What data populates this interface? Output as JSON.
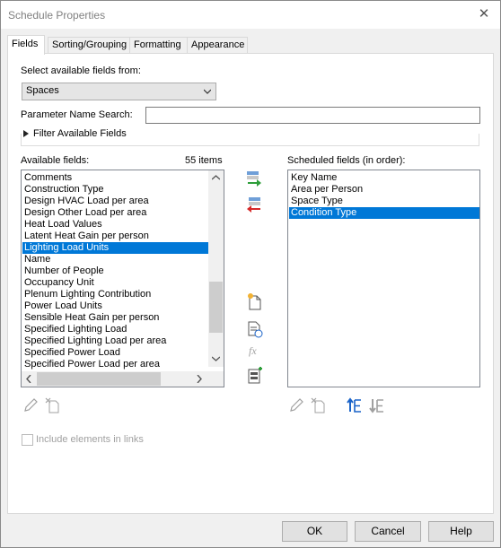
{
  "window": {
    "title": "Schedule Properties",
    "close_glyph": "✕"
  },
  "tabs": [
    {
      "label": "Fields",
      "active": true
    },
    {
      "label": "Sorting/Grouping",
      "active": false
    },
    {
      "label": "Formatting",
      "active": false
    },
    {
      "label": "Appearance",
      "active": false
    }
  ],
  "fields_tab": {
    "select_from_label": "Select available fields from:",
    "select_from_value": "Spaces",
    "param_search_label": "Parameter Name Search:",
    "param_search_value": "",
    "filter_label": "Filter Available Fields",
    "available_label": "Available fields:",
    "available_count": "55 items",
    "available_items": [
      "Comments",
      "Construction Type",
      "Design HVAC Load per area",
      "Design Other Load per area",
      "Heat Load Values",
      "Latent Heat Gain per person",
      "Lighting Load Units",
      "Name",
      "Number of People",
      "Occupancy Unit",
      "Plenum Lighting Contribution",
      "Power Load Units",
      "Sensible Heat Gain per person",
      "Specified Lighting Load",
      "Specified Lighting Load per area",
      "Specified Power Load",
      "Specified Power Load per area"
    ],
    "available_selected": "Lighting Load Units",
    "scheduled_label": "Scheduled fields (in order):",
    "scheduled_items": [
      "Key Name",
      "Area per Person",
      "Space Type",
      "Condition Type"
    ],
    "scheduled_selected": "Condition Type",
    "include_links_label": "Include elements in links",
    "include_links_checked": false
  },
  "buttons": {
    "ok": "OK",
    "cancel": "Cancel",
    "help": "Help"
  },
  "icons": {
    "add_field": "add-field-icon",
    "remove_field": "remove-field-icon",
    "new_parameter": "new-parameter-icon",
    "calculated_value": "calculated-value-icon",
    "fx": "fx-icon",
    "combine_parameters": "combine-parameters-icon",
    "edit_parameter": "edit-parameter-icon",
    "delete_parameter": "delete-parameter-icon",
    "move_up": "move-up-icon",
    "move_down": "move-down-icon",
    "fx_glyph": "fx"
  },
  "colors": {
    "selection": "#0078d7",
    "add_arrow": "#2e9e3a",
    "remove_arrow": "#d62828",
    "move_arrow": "#1a63c8"
  }
}
